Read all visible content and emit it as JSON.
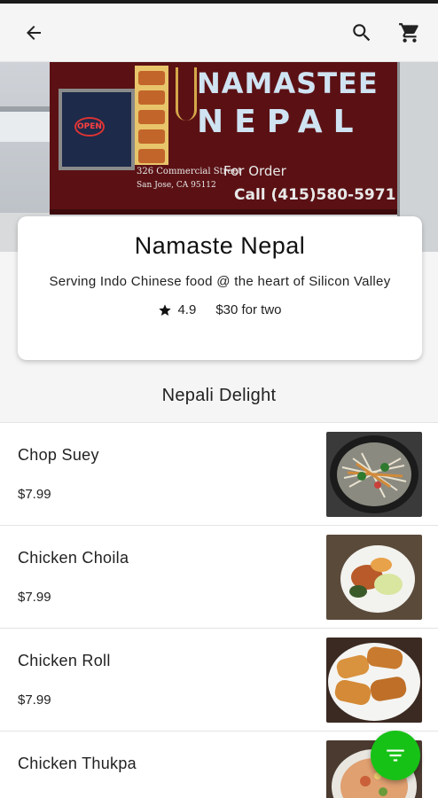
{
  "app_bar": {
    "back_icon": "arrow-back-icon",
    "search_icon": "search-icon",
    "cart_icon": "shopping-cart-icon"
  },
  "hero": {
    "truck_title_line1": "NAMASTEE",
    "truck_title_line2": "NEPAL",
    "truck_address_line1": "326 Commercial Street",
    "truck_address_line2": "San Jose, CA 95112",
    "truck_order_label": "For Order",
    "truck_phone": "Call (415)580-5971",
    "open_sign": "OPEN"
  },
  "restaurant": {
    "name": "Namaste Nepal",
    "tagline": "Serving Indo Chinese food @ the heart of Silicon Valley",
    "rating": "4.9",
    "price_for_two": "$30 for two"
  },
  "menu": {
    "section_title": "Nepali Delight",
    "items": [
      {
        "name": "Chop Suey",
        "price": "$7.99"
      },
      {
        "name": "Chicken Choila",
        "price": "$7.99"
      },
      {
        "name": "Chicken Roll",
        "price": "$7.99"
      },
      {
        "name": "Chicken Thukpa",
        "price": ""
      }
    ]
  },
  "fab": {
    "icon": "filter-icon"
  },
  "colors": {
    "fab": "#17c217",
    "truck": "#5b1114",
    "truck_title": "#cfe3f2"
  }
}
